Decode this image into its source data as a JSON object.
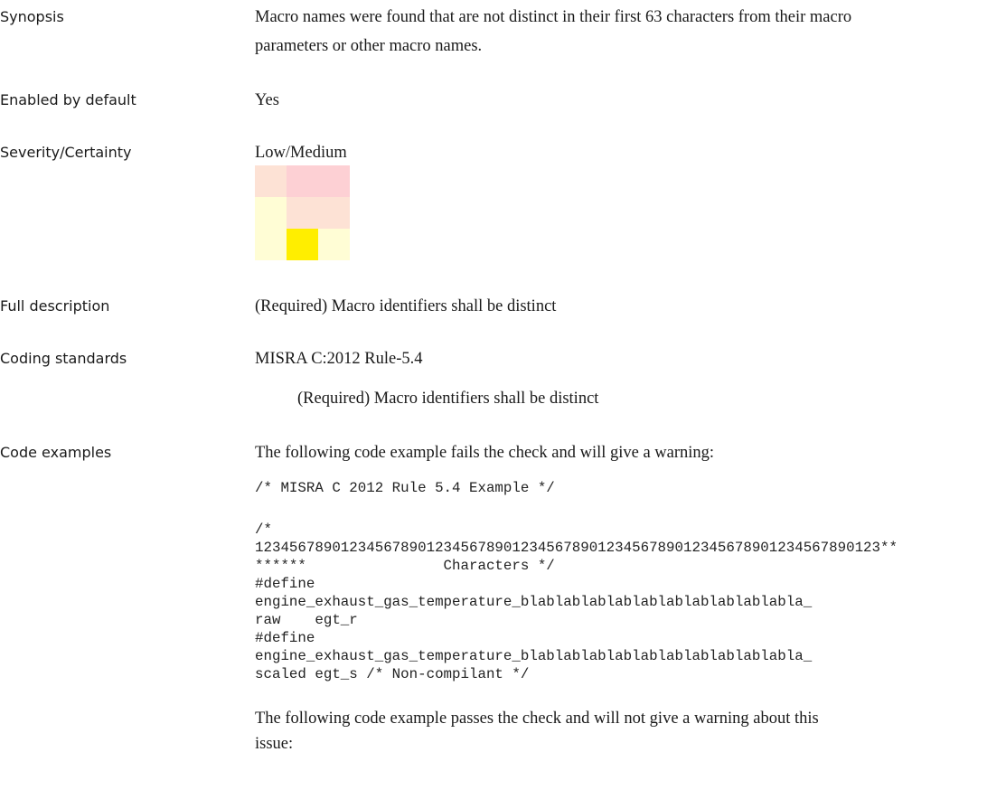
{
  "synopsis": {
    "label": "Synopsis",
    "line1": "Macro names were found that are not distinct in their first 63 characters from their macro",
    "line2": "parameters or other macro names."
  },
  "enabled_by_default": {
    "label": "Enabled by default",
    "value": "Yes"
  },
  "severity_certainty": {
    "label": "Severity/Certainty",
    "value": "Low/Medium",
    "matrix_colors": [
      [
        "#fde2d5",
        "#fdd0d4",
        "#fdd0d4"
      ],
      [
        "#fffdd5",
        "#fde2d5",
        "#fde2d5"
      ],
      [
        "#fffdd5",
        "#ffee00",
        "#fffdd5"
      ]
    ]
  },
  "full_description": {
    "label": "Full description",
    "value": "(Required) Macro identifiers shall be distinct"
  },
  "coding_standards": {
    "label": "Coding standards",
    "standard": "MISRA C:2012 Rule-5.4",
    "detail": "(Required) Macro identifiers shall be distinct"
  },
  "code_examples": {
    "label": "Code examples",
    "fail_intro": "The following code example fails the check and will give a warning:",
    "code_line_1": "/* MISRA C 2012 Rule 5.4 Example */",
    "code_line_2": "/*",
    "code_line_3": "1234567890123456789012345678901234567890123456789012345678901234567890123**",
    "code_line_4": "******                Characters */",
    "code_line_5": "#define",
    "code_line_6": "engine_exhaust_gas_temperature_blablablablablablablablablablabla_",
    "code_line_7": "raw    egt_r",
    "code_line_8": "#define",
    "code_line_9": "engine_exhaust_gas_temperature_blablablablablablablablablablabla_",
    "code_line_10": "scaled egt_s /* Non-compilant */",
    "pass_intro_line1": "The following code example passes the check and will not give a warning about this",
    "pass_intro_line2": "issue:"
  }
}
